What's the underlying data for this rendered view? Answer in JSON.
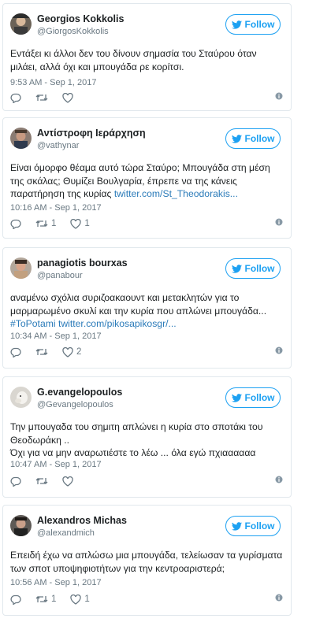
{
  "follow_label": "Follow",
  "tweets": [
    {
      "name": "Georgios Kokkolis",
      "handle": "@GiorgosKokkolis",
      "text_lines": [
        "Εντάξει κι άλλοι δεν του δίνουν σημασία του Σταύρου όταν",
        "μιλάει, αλλά όχι και μπουγάδα ρε κορίτσι."
      ],
      "link_line": "",
      "link_prefix": "",
      "hashtag": "",
      "time": "9:53 AM - Sep 1, 2017",
      "retweets": "",
      "likes": ""
    },
    {
      "name": "Αντίστροφη Ιεράρχηση",
      "handle": "@vathynar",
      "text_lines": [
        "Είναι όμορφο θέαμα αυτό τώρα Σταύρο; Μπουγάδα στη μέση",
        "της σκάλας; Θυμίζει Βουλγαρία, έπρεπε να της κάνεις"
      ],
      "link_prefix": "παρατήρηση της κυρίας ",
      "link_line": "twitter.com/St_Theodorakis...",
      "hashtag": "",
      "time": "10:16 AM - Sep 1, 2017",
      "retweets": "1",
      "likes": "1"
    },
    {
      "name": "panagiotis bourxas",
      "handle": "@panabour",
      "text_lines": [
        "αναμένω σχόλια συριζοακαουντ και μετακλητών για το",
        "μαρμαρωμένο σκυλί και την κυρία που απλώνει μπουγάδα..."
      ],
      "link_prefix": "",
      "hashtag": "#ToPotami",
      "link_line": "twitter.com/pikosapikosgr/...",
      "time": "10:34 AM - Sep 1, 2017",
      "retweets": "",
      "likes": "2"
    },
    {
      "name": "G.evangelopoulos",
      "handle": "@Gevangelopoulos",
      "text_lines": [
        "Την μπουγαδα του σημιτη απλώνει η κυρία στο σποτάκι του",
        "Θεοδωράκη ..",
        "Όχι για να μην αναρωτιέστε το λέω ... όλα εγώ πχιαααααα"
      ],
      "link_prefix": "",
      "link_line": "",
      "hashtag": "",
      "time": "10:47 AM - Sep 1, 2017",
      "retweets": "",
      "likes": ""
    },
    {
      "name": "Alexandros Michas",
      "handle": "@alexandmich",
      "text_lines": [
        "Επειδή έχω να απλώσω μια μπουγάδα, τελείωσαν τα γυρίσματα",
        "των σποτ υποψηφιοτήτων για την κεντροαριστερά;"
      ],
      "link_prefix": "",
      "link_line": "",
      "hashtag": "",
      "time": "10:56 AM - Sep 1, 2017",
      "retweets": "1",
      "likes": "1"
    }
  ]
}
